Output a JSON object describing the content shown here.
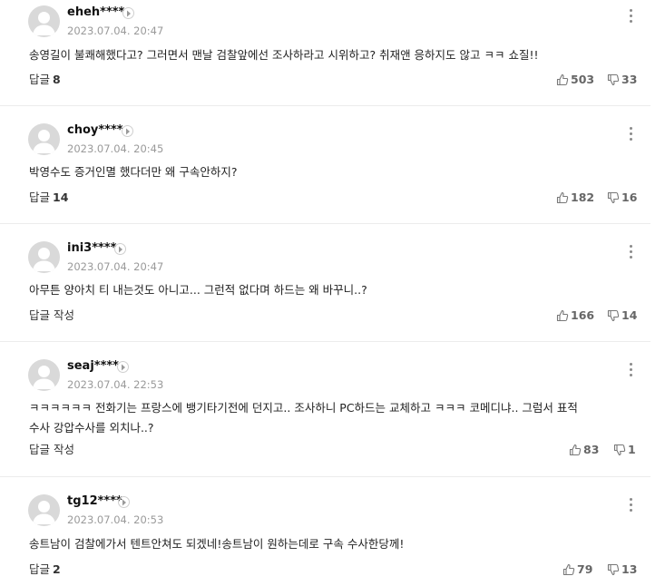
{
  "labels": {
    "reply_write": "답글 작성",
    "reply": "답글"
  },
  "comments": [
    {
      "username": "eheh****",
      "timestamp": "2023.07.04. 20:47",
      "text": "송영길이 불쾌해했다고? 그러면서 맨날 검찰앞에선 조사하라고 시위하고? 취재앤 응하지도 않고 ㅋㅋ 쇼질!!",
      "reply_label": "답글",
      "reply_count": "8",
      "likes": "503",
      "dislikes": "33"
    },
    {
      "username": "choy****",
      "timestamp": "2023.07.04. 20:45",
      "text": "박영수도 증거인멸 했다더만 왜 구속안하지?",
      "reply_label": "답글",
      "reply_count": "14",
      "likes": "182",
      "dislikes": "16"
    },
    {
      "username": "ini3****",
      "timestamp": "2023.07.04. 20:47",
      "text": "아무튼 양아치 티 내는것도 아니고... 그런적 없다며 하드는 왜 바꾸니..?",
      "reply_label": "답글 작성",
      "reply_count": "",
      "likes": "166",
      "dislikes": "14"
    },
    {
      "username": "seaj****",
      "timestamp": "2023.07.04. 22:53",
      "text_line1": "ㅋㅋㅋㅋㅋㅋ 전화기는 프랑스에 뱅기타기전에 던지고.. 조사하니 PC하드는 교체하고 ㅋㅋㅋ 코메디냐.. 그럼서 표적",
      "text_line2": "수사 강압수사를 외치나..?",
      "reply_label": "답글 작성",
      "reply_count": "",
      "likes": "83",
      "dislikes": "1"
    },
    {
      "username": "tg12****",
      "timestamp": "2023.07.04. 20:53",
      "text": "송트남이 검찰에가서 텐트안쳐도 되겠네!송트남이 원하는데로 구속 수사한당께!",
      "reply_label": "답글",
      "reply_count": "2",
      "likes": "79",
      "dislikes": "13"
    }
  ]
}
